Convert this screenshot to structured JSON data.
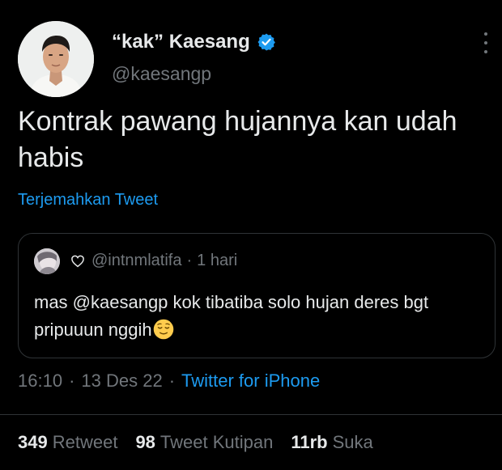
{
  "author": {
    "display_name": "“kak” Kaesang",
    "handle": "@kaesangp",
    "verified": true
  },
  "tweet": {
    "text": "Kontrak pawang hujannya kan udah habis",
    "translate_label": "Terjemahkan Tweet"
  },
  "quoted": {
    "handle": "@intnmlatifa",
    "time": "1 hari",
    "text": "mas @kaesangp kok tibatiba solo hujan deres bgt pripuuun nggih"
  },
  "meta": {
    "time": "16:10",
    "date": "13 Des 22",
    "source": "Twitter for iPhone"
  },
  "stats": {
    "retweets_count": "349",
    "retweets_label": "Retweet",
    "quotes_count": "98",
    "quotes_label": "Tweet Kutipan",
    "likes_count": "11rb",
    "likes_label": "Suka"
  },
  "colors": {
    "background": "#000000",
    "text": "#e7e9ea",
    "muted": "#71767b",
    "accent": "#1d9bf0",
    "border": "#2f3336"
  }
}
